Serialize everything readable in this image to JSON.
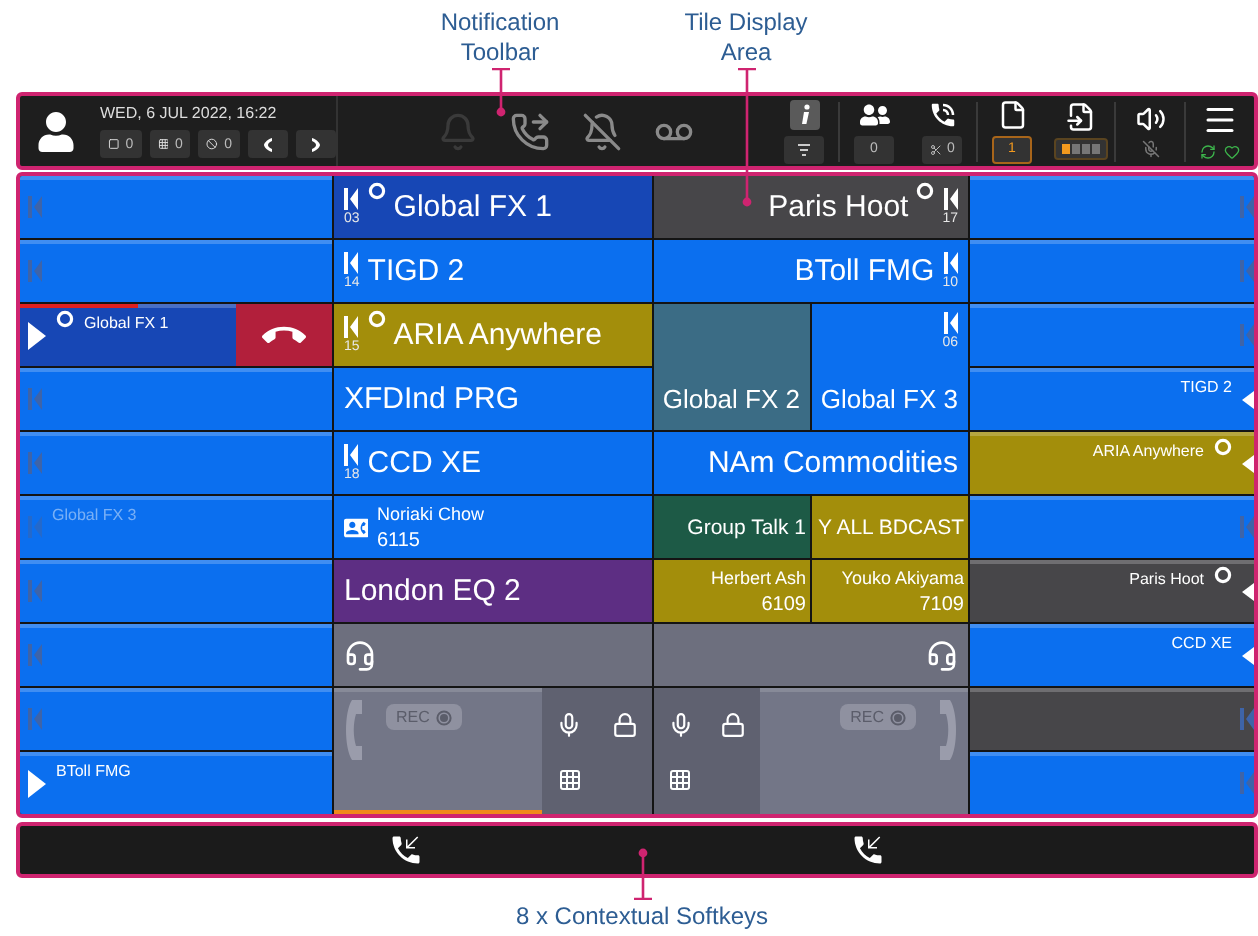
{
  "annotations": [
    {
      "text": "Notification Toolbar"
    },
    {
      "text": "Tile Display Area"
    },
    {
      "text": "8 x Contextual Softkeys"
    }
  ],
  "toolbar": {
    "datetime": "WED, 6 JUL 2022, 16:22",
    "counters": [
      {
        "kind": "filter",
        "value": "0"
      },
      {
        "kind": "hold",
        "value": "0"
      },
      {
        "kind": "blocked",
        "value": "0"
      }
    ],
    "alerts": [
      {
        "kind": "bell",
        "disabled": true
      },
      {
        "kind": "forward",
        "disabled": false
      },
      {
        "kind": "bell_off",
        "disabled": false
      },
      {
        "kind": "voicemail",
        "disabled": false
      }
    ],
    "status": [
      {
        "kind": "users",
        "value": "0"
      },
      {
        "kind": "transfer",
        "value": "0"
      },
      {
        "kind": "documents",
        "value": "1"
      }
    ],
    "queue": {
      "level": 0.25
    }
  },
  "left_column": [
    {
      "color": "#0b6fef",
      "playing": false,
      "active": false,
      "disabled": false,
      "monitored": false
    },
    {
      "color": "#0b6fef",
      "playing": false,
      "active": false,
      "disabled": false,
      "monitored": false
    },
    {
      "label": "Global FX 1",
      "color": "#1747b5",
      "playing": true,
      "active": true,
      "disabled": false,
      "monitored": true,
      "level": 0.38
    },
    {
      "color": "#0b6fef",
      "playing": false,
      "active": false,
      "disabled": false,
      "monitored": false
    },
    {
      "color": "#0b6fef",
      "playing": false,
      "active": false,
      "disabled": false,
      "monitored": false
    },
    {
      "label": "Global FX 3",
      "color": "#0b6fef",
      "playing": false,
      "active": false,
      "disabled": true,
      "monitored": false
    },
    {
      "color": "#0b6fef",
      "playing": false,
      "active": false,
      "disabled": false,
      "monitored": false
    },
    {
      "color": "#0b6fef",
      "playing": false,
      "active": false,
      "disabled": false,
      "monitored": false
    },
    {
      "color": "#0b6fef",
      "playing": false,
      "active": false,
      "disabled": false,
      "monitored": false
    },
    {
      "label": "BToll FMG",
      "color": "#0b6fef",
      "playing": true,
      "active": false,
      "disabled": false,
      "monitored": false
    }
  ],
  "tiles": [
    {
      "kind": "line",
      "label": "Global FX 1",
      "number": "03",
      "monitored": true,
      "color": "#1747b5"
    },
    {
      "kind": "line",
      "label": "Paris Hoot",
      "number": "17",
      "monitored": true,
      "color": "#474649"
    },
    {
      "kind": "line",
      "label": "TIGD 2",
      "number": "14",
      "monitored": false,
      "color": "#0b6fef"
    },
    {
      "kind": "line",
      "label": "BToll FMG",
      "number": "10",
      "monitored": false,
      "color": "#0b6fef"
    },
    {
      "kind": "line",
      "label": "ARIA Anywhere",
      "number": "15",
      "monitored": true,
      "color": "#a38e0b"
    },
    {
      "kind": "line",
      "label": "XFDInd PRG",
      "monitored": false,
      "color": "#0b6fef"
    },
    {
      "kind": "line",
      "label": "Global FX 2",
      "monitored": false,
      "color": "#3b6c85"
    },
    {
      "kind": "line",
      "label": "Global FX 3",
      "number": "06",
      "monitored": false,
      "color": "#0b6fef"
    },
    {
      "kind": "line",
      "label": "CCD XE",
      "number": "18",
      "monitored": false,
      "color": "#0b6fef"
    },
    {
      "kind": "line",
      "label": "NAm Commodities",
      "monitored": false,
      "color": "#0b6fef"
    },
    {
      "kind": "phone_contact",
      "name": "Noriaki Chow",
      "extension": "6115",
      "color": "#0b6fef"
    },
    {
      "kind": "line",
      "label": "Group Talk 1",
      "monitored": false,
      "color": "#1d5a46"
    },
    {
      "kind": "line",
      "label": "Y ALL BDCAST",
      "monitored": false,
      "color": "#a38e0b"
    },
    {
      "kind": "line",
      "label": "London EQ 2",
      "monitored": false,
      "color": "#5d2e83"
    },
    {
      "kind": "contact",
      "name": "Herbert Ash",
      "extension": "6109",
      "color": "#a38e0b"
    },
    {
      "kind": "contact",
      "name": "Youko Akiyama",
      "extension": "7109",
      "color": "#a38e0b"
    },
    {
      "kind": "headset",
      "color": "#6d6f7e"
    },
    {
      "kind": "headset",
      "color": "#6d6f7e"
    },
    {
      "kind": "handset",
      "rec_label": "REC",
      "active": true
    },
    {
      "kind": "handset",
      "rec_label": "REC",
      "active": false
    }
  ],
  "right_column": [
    {
      "color": "#0b6fef",
      "monitored": false
    },
    {
      "color": "#0b6fef",
      "monitored": false
    },
    {
      "color": "#0b6fef",
      "monitored": false
    },
    {
      "label": "TIGD 2",
      "color": "#0b6fef",
      "monitored": false
    },
    {
      "label": "ARIA Anywhere",
      "color": "#a38e0b",
      "monitored": true
    },
    {
      "color": "#0b6fef",
      "monitored": false
    },
    {
      "label": "Paris Hoot",
      "color": "#474649",
      "monitored": true
    },
    {
      "label": "CCD XE",
      "color": "#0b6fef",
      "monitored": false
    },
    {
      "color": "#474649",
      "monitored": false
    },
    {
      "color": "#0b6fef",
      "monitored": false
    }
  ],
  "softkeys": [
    {
      "kind": "empty"
    },
    {
      "kind": "empty"
    },
    {
      "kind": "callback"
    },
    {
      "kind": "empty"
    },
    {
      "kind": "empty"
    },
    {
      "kind": "callback"
    },
    {
      "kind": "empty"
    },
    {
      "kind": "empty"
    }
  ]
}
